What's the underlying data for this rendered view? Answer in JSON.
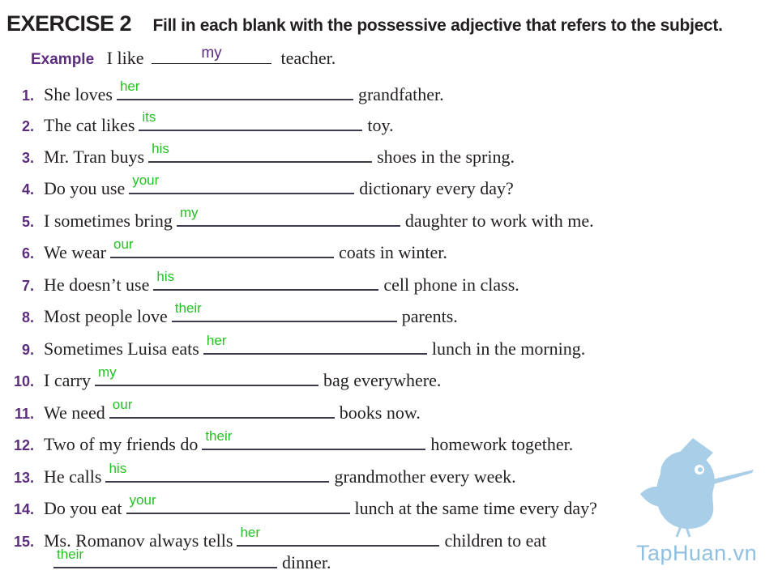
{
  "header": {
    "exercise_title": "EXERCISE 2",
    "instruction": "Fill in each blank with the possessive adjective that refers to the subject."
  },
  "example": {
    "label": "Example",
    "before": "I like",
    "answer": "my",
    "after": "teacher."
  },
  "items": [
    {
      "num": "1.",
      "before": "She loves",
      "answer": "her",
      "after": "grandfather."
    },
    {
      "num": "2.",
      "before": "The cat likes",
      "answer": "its",
      "after": "toy."
    },
    {
      "num": "3.",
      "before": "Mr. Tran buys",
      "answer": "his",
      "after": "shoes in the spring."
    },
    {
      "num": "4.",
      "before": "Do you use",
      "answer": "your",
      "after": "dictionary every day?"
    },
    {
      "num": "5.",
      "before": "I sometimes bring",
      "answer": "my",
      "after": "daughter to work with me."
    },
    {
      "num": "6.",
      "before": "We wear",
      "answer": "our",
      "after": "coats in winter."
    },
    {
      "num": "7.",
      "before": "He doesn’t use",
      "answer": "his",
      "after": "cell phone in class."
    },
    {
      "num": "8.",
      "before": "Most people love",
      "answer": "their",
      "after": "parents."
    },
    {
      "num": "9.",
      "before": "Sometimes Luisa eats",
      "answer": "her",
      "after": "lunch in the morning."
    },
    {
      "num": "10.",
      "before": "I carry",
      "answer": "my",
      "after": "bag everywhere."
    },
    {
      "num": "11.",
      "before": "We need",
      "answer": "our",
      "after": "books now."
    },
    {
      "num": "12.",
      "before": "Two of my friends do",
      "answer": "their",
      "after": "homework together."
    },
    {
      "num": "13.",
      "before": "He calls",
      "answer": "his",
      "after": "grandmother every week."
    },
    {
      "num": "14.",
      "before": "Do you eat",
      "answer": "your",
      "after": "lunch at the same time every day?"
    },
    {
      "num": "15.",
      "before": "Ms. Romanov always tells",
      "answer": "her",
      "after": "children to eat"
    }
  ],
  "item15_continuation": {
    "answer": "their",
    "after": "dinner."
  },
  "watermark": {
    "text": "TapHuan.vn",
    "icon": "bird-mascot-icon"
  },
  "colors": {
    "number_purple": "#5c2d7d",
    "answer_green": "#22c322",
    "watermark_blue": "#8fc0e0"
  }
}
